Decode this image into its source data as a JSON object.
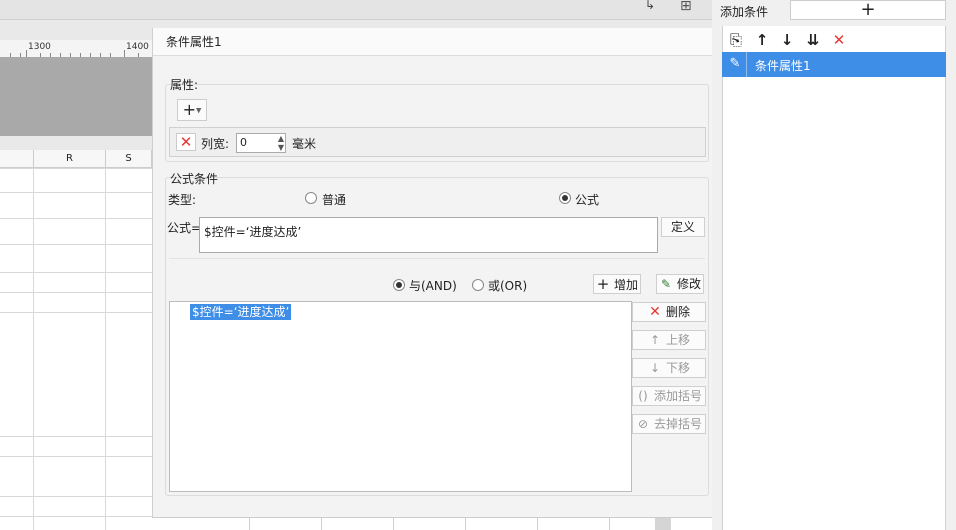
{
  "ruler": {
    "mark1": "1300",
    "mark2": "1400"
  },
  "sheet": {
    "col_r": "R",
    "col_s": "S"
  },
  "dialog": {
    "title": "条件属性1",
    "attributes": {
      "group_label": "属性:",
      "add_icon": "plus-icon",
      "col_width_label": "列宽:",
      "col_width_value": "0",
      "unit": "毫米"
    },
    "formula_condition": {
      "group_label": "公式条件",
      "type_label": "类型:",
      "type_options": [
        {
          "label": "普通",
          "selected": false
        },
        {
          "label": "公式",
          "selected": true
        }
      ],
      "formula_label": "公式=",
      "formula_value": "$控件=‘进度达成’",
      "define_button": "定义",
      "logic_and": "与(AND)",
      "logic_or": "或(OR)",
      "logic_selected": "and",
      "add_button": "增加",
      "modify_button": "修改",
      "list_items": [
        "$控件=‘进度达成’"
      ],
      "delete_button": "删除",
      "move_up_button": "上移",
      "move_down_button": "下移",
      "add_bracket_button": "添加括号",
      "remove_bracket_button": "去掉括号"
    }
  },
  "right_panel": {
    "add_condition_label": "添加条件",
    "add_button_symbol": "+",
    "toolbar_icons": [
      "copy-icon",
      "arrow-up-icon",
      "arrow-down-icon",
      "sort-icon",
      "delete-icon"
    ],
    "items": [
      {
        "label": "条件属性1",
        "selected": true
      }
    ]
  },
  "colors": {
    "selection": "#3e8ee8",
    "delete_red": "#e53935",
    "accent_green": "#2e7d32"
  }
}
